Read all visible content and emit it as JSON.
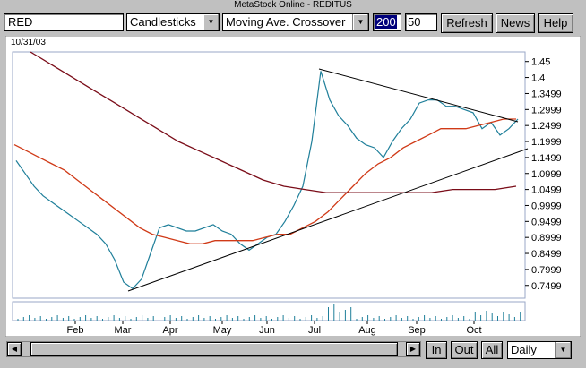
{
  "window": {
    "title": "MetaStock Online - REDITUS"
  },
  "toolbar": {
    "symbol": "RED",
    "chart_type": "Candlesticks",
    "indicator": "Moving Ave. Crossover",
    "param1": "200",
    "param2": "50",
    "refresh_label": "Refresh",
    "news_label": "News",
    "help_label": "Help"
  },
  "chart": {
    "date_label": "10/31/03",
    "colors": {
      "price": "#1f7f9a",
      "ma_fast": "#d03a17",
      "ma_slow": "#7a0c18",
      "trend": "#000000"
    }
  },
  "chart_data": {
    "type": "line",
    "title": "",
    "x_months": [
      "Feb",
      "Mar",
      "Apr",
      "May",
      "Jun",
      "Jul",
      "Aug",
      "Sep",
      "Oct"
    ],
    "y_ticks": [
      "1.45",
      "1.4",
      "1.3499",
      "1.2999",
      "1.2499",
      "1.1999",
      "1.1499",
      "1.0999",
      "1.0499",
      "0.9999",
      "0.9499",
      "0.8999",
      "0.8499",
      "0.7999",
      "0.7499"
    ],
    "ylim": [
      0.71,
      1.48
    ],
    "series": [
      {
        "name": "",
        "values": [
          1.14,
          1.1,
          1.06,
          1.03,
          1.01,
          0.99,
          0.97,
          0.95,
          0.93,
          0.91,
          0.88,
          0.83,
          0.76,
          0.74,
          0.77,
          0.85,
          0.93,
          0.94,
          0.93,
          0.92,
          0.92,
          0.93,
          0.94,
          0.92,
          0.91,
          0.88,
          0.86,
          0.88,
          0.9,
          0.91,
          0.95,
          1.0,
          1.06,
          1.2,
          1.42,
          1.33,
          1.28,
          1.25,
          1.21,
          1.19,
          1.18,
          1.15,
          1.2,
          1.24,
          1.27,
          1.32,
          1.33,
          1.33,
          1.31,
          1.31,
          1.3,
          1.29,
          1.24,
          1.26,
          1.22,
          1.24,
          1.27
        ]
      },
      {
        "name": "",
        "values": [
          1.19,
          1.17,
          1.15,
          1.13,
          1.11,
          1.08,
          1.05,
          1.02,
          0.99,
          0.96,
          0.93,
          0.91,
          0.9,
          0.89,
          0.88,
          0.88,
          0.89,
          0.89,
          0.89,
          0.89,
          0.9,
          0.91,
          0.91,
          0.93,
          0.95,
          0.98,
          1.02,
          1.06,
          1.1,
          1.13,
          1.15,
          1.18,
          1.2,
          1.22,
          1.24,
          1.24,
          1.24,
          1.25,
          1.26,
          1.27,
          1.27
        ]
      },
      {
        "name": "",
        "values": [
          1.48,
          1.44,
          1.4,
          1.36,
          1.32,
          1.28,
          1.24,
          1.2,
          1.17,
          1.14,
          1.11,
          1.08,
          1.06,
          1.05,
          1.04,
          1.04,
          1.04,
          1.04,
          1.04,
          1.04,
          1.05,
          1.05,
          1.05,
          1.06
        ]
      }
    ]
  },
  "bottom": {
    "in_label": "In",
    "out_label": "Out",
    "all_label": "All",
    "period": "Daily"
  }
}
